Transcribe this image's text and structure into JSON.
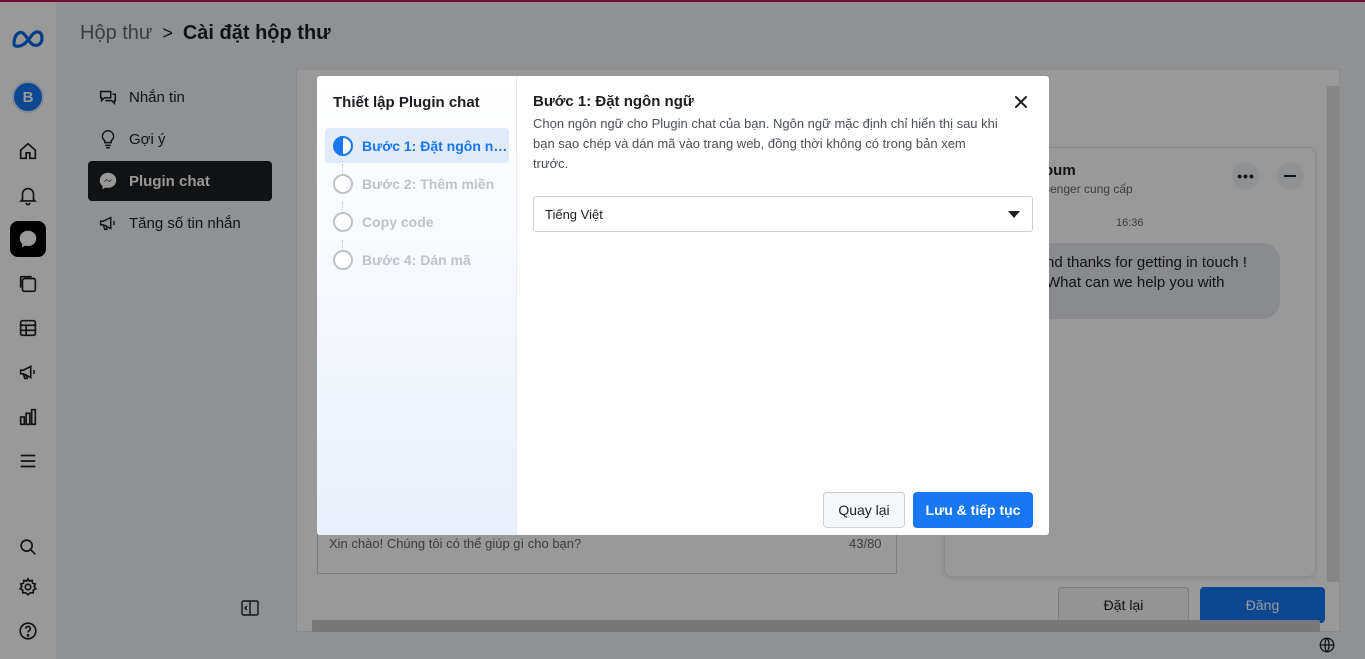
{
  "colors": {
    "accent": "#1877f2",
    "active_nav": "#1c1e21",
    "top_line": "#c5135a"
  },
  "rail": {
    "avatar_letter": "B",
    "icons": [
      "meta-logo-icon",
      "home-icon",
      "bell-icon",
      "chat-bubble-icon",
      "pages-icon",
      "table-icon",
      "megaphone-icon",
      "bar-chart-icon",
      "menu-icon",
      "search-icon",
      "settings-gear-icon",
      "help-icon"
    ]
  },
  "header": {
    "breadcrumb_parent": "Hộp thư",
    "breadcrumb_separator": ">",
    "breadcrumb_current": "Cài đặt hộp thư"
  },
  "settings_nav": {
    "items": [
      {
        "label": "Nhắn tin",
        "icon": "message-icon",
        "active": false
      },
      {
        "label": "Gợi ý",
        "icon": "lightbulb-icon",
        "active": false
      },
      {
        "label": "Plugin chat",
        "icon": "messenger-icon",
        "active": true
      },
      {
        "label": "Tăng số tin nhắn",
        "icon": "megaphone-icon",
        "active": false
      }
    ]
  },
  "background": {
    "preview": {
      "page_name": "oum",
      "subtitle": "senger cung cấp",
      "time": "16:36",
      "message": "nd thanks for getting in touch ! What can we help you with"
    },
    "greeting_text": "Xin chào! Chúng tôi có thể giúp gì cho bạn?",
    "greeting_count": "43/80",
    "reset_label": "Đặt lại",
    "post_label": "Đăng"
  },
  "modal": {
    "side_title": "Thiết lập Plugin chat",
    "steps": [
      {
        "label": "Bước 1: Đặt ngôn ngữ",
        "active": true
      },
      {
        "label": "Bước 2: Thêm miền",
        "active": false
      },
      {
        "label": "Copy code",
        "active": false
      },
      {
        "label": "Bước 4: Dán mã",
        "active": false
      }
    ],
    "title": "Bước 1: Đặt ngôn ngữ",
    "description": "Chọn ngôn ngữ cho Plugin chat của bạn. Ngôn ngữ mặc định chỉ hiển thị sau khi bạn sao chép và dán mã vào trang web, đồng thời không có trong bản xem trước.",
    "language_selected": "Tiếng Việt",
    "back_label": "Quay lại",
    "next_label": "Lưu & tiếp tục"
  }
}
